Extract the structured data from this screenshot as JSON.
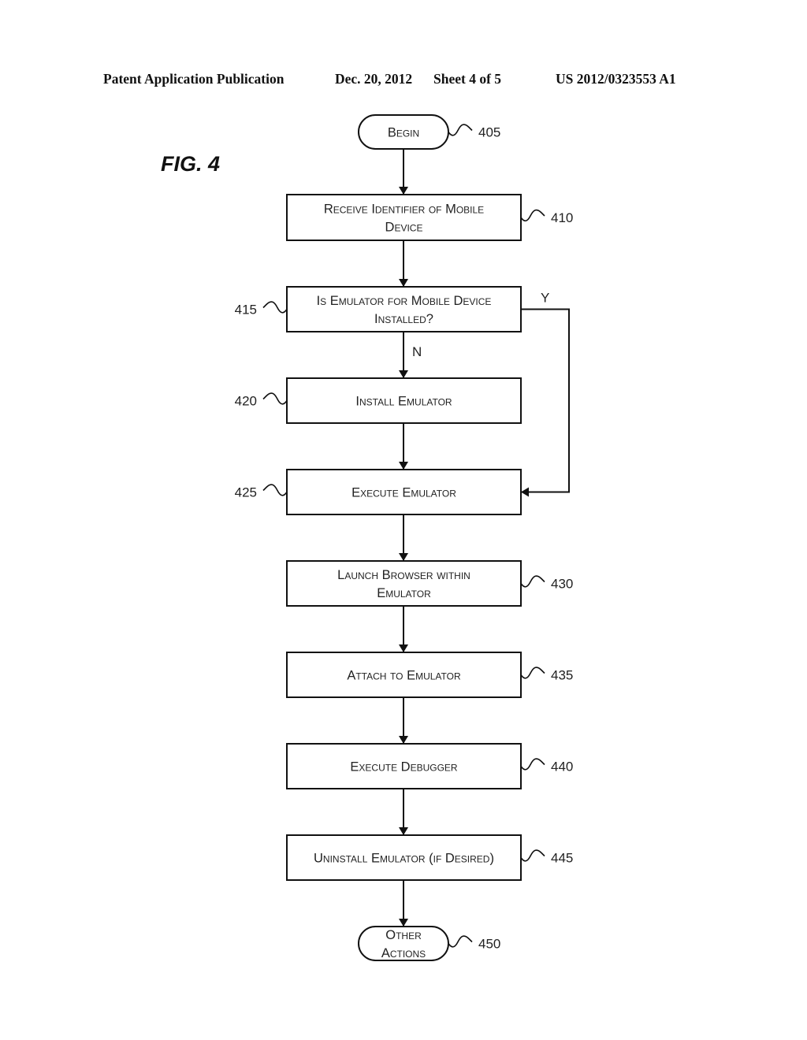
{
  "header": {
    "publication": "Patent Application Publication",
    "date": "Dec. 20, 2012",
    "sheet": "Sheet 4 of 5",
    "number": "US 2012/0323553 A1"
  },
  "figure_label": "FIG. 4",
  "flowchart": {
    "nodes": [
      {
        "id": "405",
        "shape": "terminal",
        "lines": [
          "Begin"
        ],
        "ref": "405",
        "ref_side": "right"
      },
      {
        "id": "410",
        "shape": "process",
        "lines": [
          "Receive Identifier of Mobile",
          "Device"
        ],
        "ref": "410",
        "ref_side": "right"
      },
      {
        "id": "415",
        "shape": "decision",
        "lines": [
          "Is Emulator for Mobile Device",
          "Installed?"
        ],
        "ref": "415",
        "ref_side": "left"
      },
      {
        "id": "420",
        "shape": "process",
        "lines": [
          "Install Emulator"
        ],
        "ref": "420",
        "ref_side": "left"
      },
      {
        "id": "425",
        "shape": "process",
        "lines": [
          "Execute Emulator"
        ],
        "ref": "425",
        "ref_side": "left"
      },
      {
        "id": "430",
        "shape": "process",
        "lines": [
          "Launch Browser within",
          "Emulator"
        ],
        "ref": "430",
        "ref_side": "right"
      },
      {
        "id": "435",
        "shape": "process",
        "lines": [
          "Attach to Emulator"
        ],
        "ref": "435",
        "ref_side": "right"
      },
      {
        "id": "440",
        "shape": "process",
        "lines": [
          "Execute Debugger"
        ],
        "ref": "440",
        "ref_side": "right"
      },
      {
        "id": "445",
        "shape": "process",
        "lines": [
          "Uninstall Emulator (if Desired)"
        ],
        "ref": "445",
        "ref_side": "right"
      },
      {
        "id": "450",
        "shape": "terminal",
        "lines": [
          "Other",
          "Actions"
        ],
        "ref": "450",
        "ref_side": "right"
      }
    ],
    "edges": [
      {
        "from": "405",
        "to": "410",
        "label": ""
      },
      {
        "from": "410",
        "to": "415",
        "label": ""
      },
      {
        "from": "415",
        "to": "420",
        "label": "N"
      },
      {
        "from": "415",
        "to": "425",
        "label": "Y"
      },
      {
        "from": "420",
        "to": "425",
        "label": ""
      },
      {
        "from": "425",
        "to": "430",
        "label": ""
      },
      {
        "from": "430",
        "to": "435",
        "label": ""
      },
      {
        "from": "435",
        "to": "440",
        "label": ""
      },
      {
        "from": "440",
        "to": "445",
        "label": ""
      },
      {
        "from": "445",
        "to": "450",
        "label": ""
      }
    ]
  }
}
